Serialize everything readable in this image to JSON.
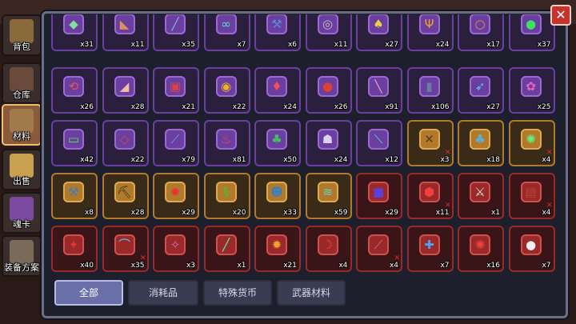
{
  "sidebar": {
    "tabs": [
      {
        "label": "背包",
        "icon": "backpack-icon",
        "active": false
      },
      {
        "label": "仓库",
        "icon": "warehouse-icon",
        "active": false
      },
      {
        "label": "材料",
        "icon": "materials-icon",
        "active": true
      },
      {
        "label": "出售",
        "icon": "sell-icon",
        "active": false
      },
      {
        "label": "魂卡",
        "icon": "soul-card-icon",
        "active": false
      },
      {
        "label": "装备方案",
        "icon": "equipment-plan-icon",
        "active": false
      }
    ]
  },
  "close_button": {
    "icon": "close-icon",
    "glyph": "✕"
  },
  "inventory": {
    "rows": [
      [
        {
          "icon": "crystal-shard-icon",
          "glyph": "◆",
          "count": "x31",
          "rarity": "purple",
          "color": "#7fe0a0"
        },
        {
          "icon": "boomerang-icon",
          "glyph": "◣",
          "count": "x11",
          "rarity": "purple",
          "color": "#e0905a"
        },
        {
          "icon": "stick-icon",
          "glyph": "╱",
          "count": "x35",
          "rarity": "purple",
          "color": "#8ab0e0"
        },
        {
          "icon": "goggles-icon",
          "glyph": "∞",
          "count": "x7",
          "rarity": "purple",
          "color": "#50e0d0"
        },
        {
          "icon": "wrench-icon",
          "glyph": "⚒",
          "count": "x6",
          "rarity": "purple",
          "color": "#5a8ae0"
        },
        {
          "icon": "coil-icon",
          "glyph": "◎",
          "count": "x11",
          "rarity": "purple",
          "color": "#c0c0c0"
        },
        {
          "icon": "bell-icon",
          "glyph": "♠",
          "count": "x27",
          "rarity": "purple",
          "color": "#f0d040"
        },
        {
          "icon": "claw-icon",
          "glyph": "Ψ",
          "count": "x24",
          "rarity": "purple",
          "color": "#f0a030"
        },
        {
          "icon": "ring-icon",
          "glyph": "○",
          "count": "x17",
          "rarity": "purple",
          "color": "#f09030"
        },
        {
          "icon": "slime-icon",
          "glyph": "●",
          "count": "x37",
          "rarity": "purple",
          "color": "#40e060"
        }
      ],
      [
        {
          "icon": "hook-icon",
          "glyph": "⟲",
          "count": "x26",
          "rarity": "purple",
          "color": "#f05050"
        },
        {
          "icon": "horn-icon",
          "glyph": "◢",
          "count": "x28",
          "rarity": "purple",
          "color": "#f0c0a0"
        },
        {
          "icon": "shield-icon",
          "glyph": "▣",
          "count": "x21",
          "rarity": "purple",
          "color": "#e04040"
        },
        {
          "icon": "amulet-icon",
          "glyph": "◉",
          "count": "x22",
          "rarity": "purple",
          "color": "#f0b020"
        },
        {
          "icon": "gem-icon",
          "glyph": "♦",
          "count": "x24",
          "rarity": "purple",
          "color": "#f05050"
        },
        {
          "icon": "eye-orb-icon",
          "glyph": "●",
          "count": "x26",
          "rarity": "purple",
          "color": "#e04030"
        },
        {
          "icon": "torch-icon",
          "glyph": "╲",
          "count": "x91",
          "rarity": "purple",
          "color": "#f0a0c0"
        },
        {
          "icon": "barrel-icon",
          "glyph": "▮",
          "count": "x106",
          "rarity": "purple",
          "color": "#6a7aa0"
        },
        {
          "icon": "dagger-icon",
          "glyph": "➶",
          "count": "x27",
          "rarity": "purple",
          "color": "#60c0f0"
        },
        {
          "icon": "flower-icon",
          "glyph": "✿",
          "count": "x25",
          "rarity": "purple",
          "color": "#f060c0"
        }
      ],
      [
        {
          "icon": "battery-icon",
          "glyph": "▭",
          "count": "x42",
          "rarity": "purple",
          "color": "#60e060"
        },
        {
          "icon": "bat-wing-icon",
          "glyph": "◇",
          "count": "x22",
          "rarity": "purple",
          "color": "#c05050"
        },
        {
          "icon": "blade-icon",
          "glyph": "⟋",
          "count": "x79",
          "rarity": "purple",
          "color": "#5ab0f0"
        },
        {
          "icon": "potion-icon",
          "glyph": "♨",
          "count": "x81",
          "rarity": "purple",
          "color": "#f05030"
        },
        {
          "icon": "cactus-icon",
          "glyph": "♣",
          "count": "x50",
          "rarity": "purple",
          "color": "#40c060"
        },
        {
          "icon": "demon-mask-icon",
          "glyph": "☗",
          "count": "x24",
          "rarity": "purple",
          "color": "#e0d0f0"
        },
        {
          "icon": "spear-icon",
          "glyph": "⟍",
          "count": "x12",
          "rarity": "purple",
          "color": "#50e0c0"
        },
        {
          "icon": "crossbow-icon",
          "glyph": "✕",
          "count": "x3",
          "rarity": "orange",
          "color": "#5a3a20",
          "locked": true
        },
        {
          "icon": "mace-icon",
          "glyph": "♣",
          "count": "x18",
          "rarity": "orange",
          "color": "#5ab0e0"
        },
        {
          "icon": "orb-staff-icon",
          "glyph": "✺",
          "count": "x4",
          "rarity": "orange",
          "color": "#60f080",
          "locked": true
        }
      ],
      [
        {
          "icon": "hammer-icon",
          "glyph": "⚒",
          "count": "x8",
          "rarity": "orange",
          "color": "#3a80c0"
        },
        {
          "icon": "pickaxe-icon",
          "glyph": "⛏",
          "count": "x28",
          "rarity": "orange",
          "color": "#3a2a20"
        },
        {
          "icon": "fire-core-icon",
          "glyph": "✹",
          "count": "x29",
          "rarity": "orange",
          "color": "#f03030"
        },
        {
          "icon": "scroll-icon",
          "glyph": "§",
          "count": "x20",
          "rarity": "orange",
          "color": "#40c040"
        },
        {
          "icon": "beast-head-icon",
          "glyph": "☻",
          "count": "x33",
          "rarity": "orange",
          "color": "#3a80c0"
        },
        {
          "icon": "fish-bone-icon",
          "glyph": "≋",
          "count": "x59",
          "rarity": "orange",
          "color": "#60d0d0"
        },
        {
          "icon": "red-cube-icon",
          "glyph": "■",
          "count": "x29",
          "rarity": "red",
          "color": "#5a40e0"
        },
        {
          "icon": "red-shield-icon",
          "glyph": "⬢",
          "count": "x11",
          "rarity": "red",
          "color": "#f04040",
          "locked": true
        },
        {
          "icon": "axe-icon",
          "glyph": "⚔",
          "count": "x1",
          "rarity": "red",
          "color": "#e0e0e0"
        },
        {
          "icon": "chest-icon",
          "glyph": "▤",
          "count": "x4",
          "rarity": "red",
          "color": "#c04030",
          "locked": true
        }
      ],
      [
        {
          "icon": "fire-wand-icon",
          "glyph": "✦",
          "count": "x40",
          "rarity": "red",
          "color": "#f03030"
        },
        {
          "icon": "bow-icon",
          "glyph": "⌒",
          "count": "x35",
          "rarity": "red",
          "color": "#60c0f0",
          "locked": true
        },
        {
          "icon": "staff-gem-icon",
          "glyph": "✧",
          "count": "x3",
          "rarity": "red",
          "color": "#f060c0"
        },
        {
          "icon": "green-sword-icon",
          "glyph": "╱",
          "count": "x1",
          "rarity": "red",
          "color": "#60f0a0"
        },
        {
          "icon": "sun-core-icon",
          "glyph": "✹",
          "count": "x21",
          "rarity": "red",
          "color": "#f0a030"
        },
        {
          "icon": "red-bow-icon",
          "glyph": "☽",
          "count": "x4",
          "rarity": "red",
          "color": "#f04040"
        },
        {
          "icon": "red-blade-icon",
          "glyph": "⟋",
          "count": "x4",
          "rarity": "red",
          "color": "#f06080",
          "locked": true
        },
        {
          "icon": "ice-spear-icon",
          "glyph": "✚",
          "count": "x7",
          "rarity": "red",
          "color": "#50a0f0"
        },
        {
          "icon": "octopus-icon",
          "glyph": "✺",
          "count": "x16",
          "rarity": "red",
          "color": "#f04040"
        },
        {
          "icon": "pearl-icon",
          "glyph": "●",
          "count": "x7",
          "rarity": "red",
          "color": "#f0f0f0"
        }
      ]
    ]
  },
  "filters": [
    {
      "label": "全部",
      "active": true
    },
    {
      "label": "消耗品",
      "active": false
    },
    {
      "label": "特殊货币",
      "active": false
    },
    {
      "label": "武器材料",
      "active": false
    }
  ],
  "colors": {
    "purple_rarity": "#6b3fa0",
    "orange_rarity": "#b07a2a",
    "red_rarity": "#9a2a2a",
    "panel_bg": "#1d1f2c",
    "close_red": "#c5332d"
  }
}
